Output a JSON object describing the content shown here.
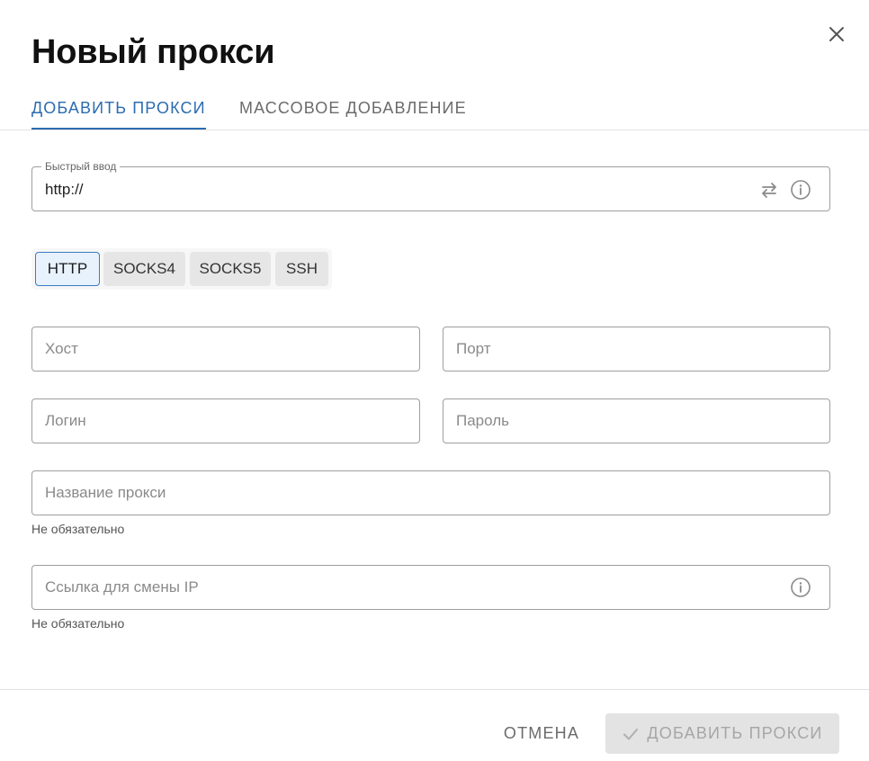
{
  "dialog": {
    "title": "Новый прокси",
    "close_icon": "close-icon"
  },
  "tabs": [
    {
      "label": "ДОБАВИТЬ ПРОКСИ",
      "active": true
    },
    {
      "label": "МАССОВОЕ ДОБАВЛЕНИЕ",
      "active": false
    }
  ],
  "quick_input": {
    "label": "Быстрый ввод",
    "value": "http://",
    "swap_icon": "swap-arrows-icon",
    "info_icon": "info-icon"
  },
  "protocols": [
    {
      "label": "HTTP",
      "selected": true
    },
    {
      "label": "SOCKS4",
      "selected": false
    },
    {
      "label": "SOCKS5",
      "selected": false
    },
    {
      "label": "SSH",
      "selected": false
    }
  ],
  "fields": {
    "host": {
      "placeholder": "Хост",
      "value": ""
    },
    "port": {
      "placeholder": "Порт",
      "value": ""
    },
    "login": {
      "placeholder": "Логин",
      "value": ""
    },
    "password": {
      "placeholder": "Пароль",
      "value": ""
    },
    "name": {
      "placeholder": "Название прокси",
      "value": "",
      "hint": "Не обязательно"
    },
    "ip_change_url": {
      "placeholder": "Ссылка для смены IP",
      "value": "",
      "hint": "Не обязательно",
      "info_icon": "info-icon"
    }
  },
  "footer": {
    "cancel_label": "ОТМЕНА",
    "submit_label": "ДОБАВИТЬ ПРОКСИ",
    "submit_icon": "check-icon",
    "submit_disabled": true
  },
  "colors": {
    "accent": "#2b6cb0",
    "active_chip_bg": "#e8f2fc",
    "disabled_button_bg": "#e3e3e3",
    "disabled_button_text": "#a6a6a6"
  }
}
